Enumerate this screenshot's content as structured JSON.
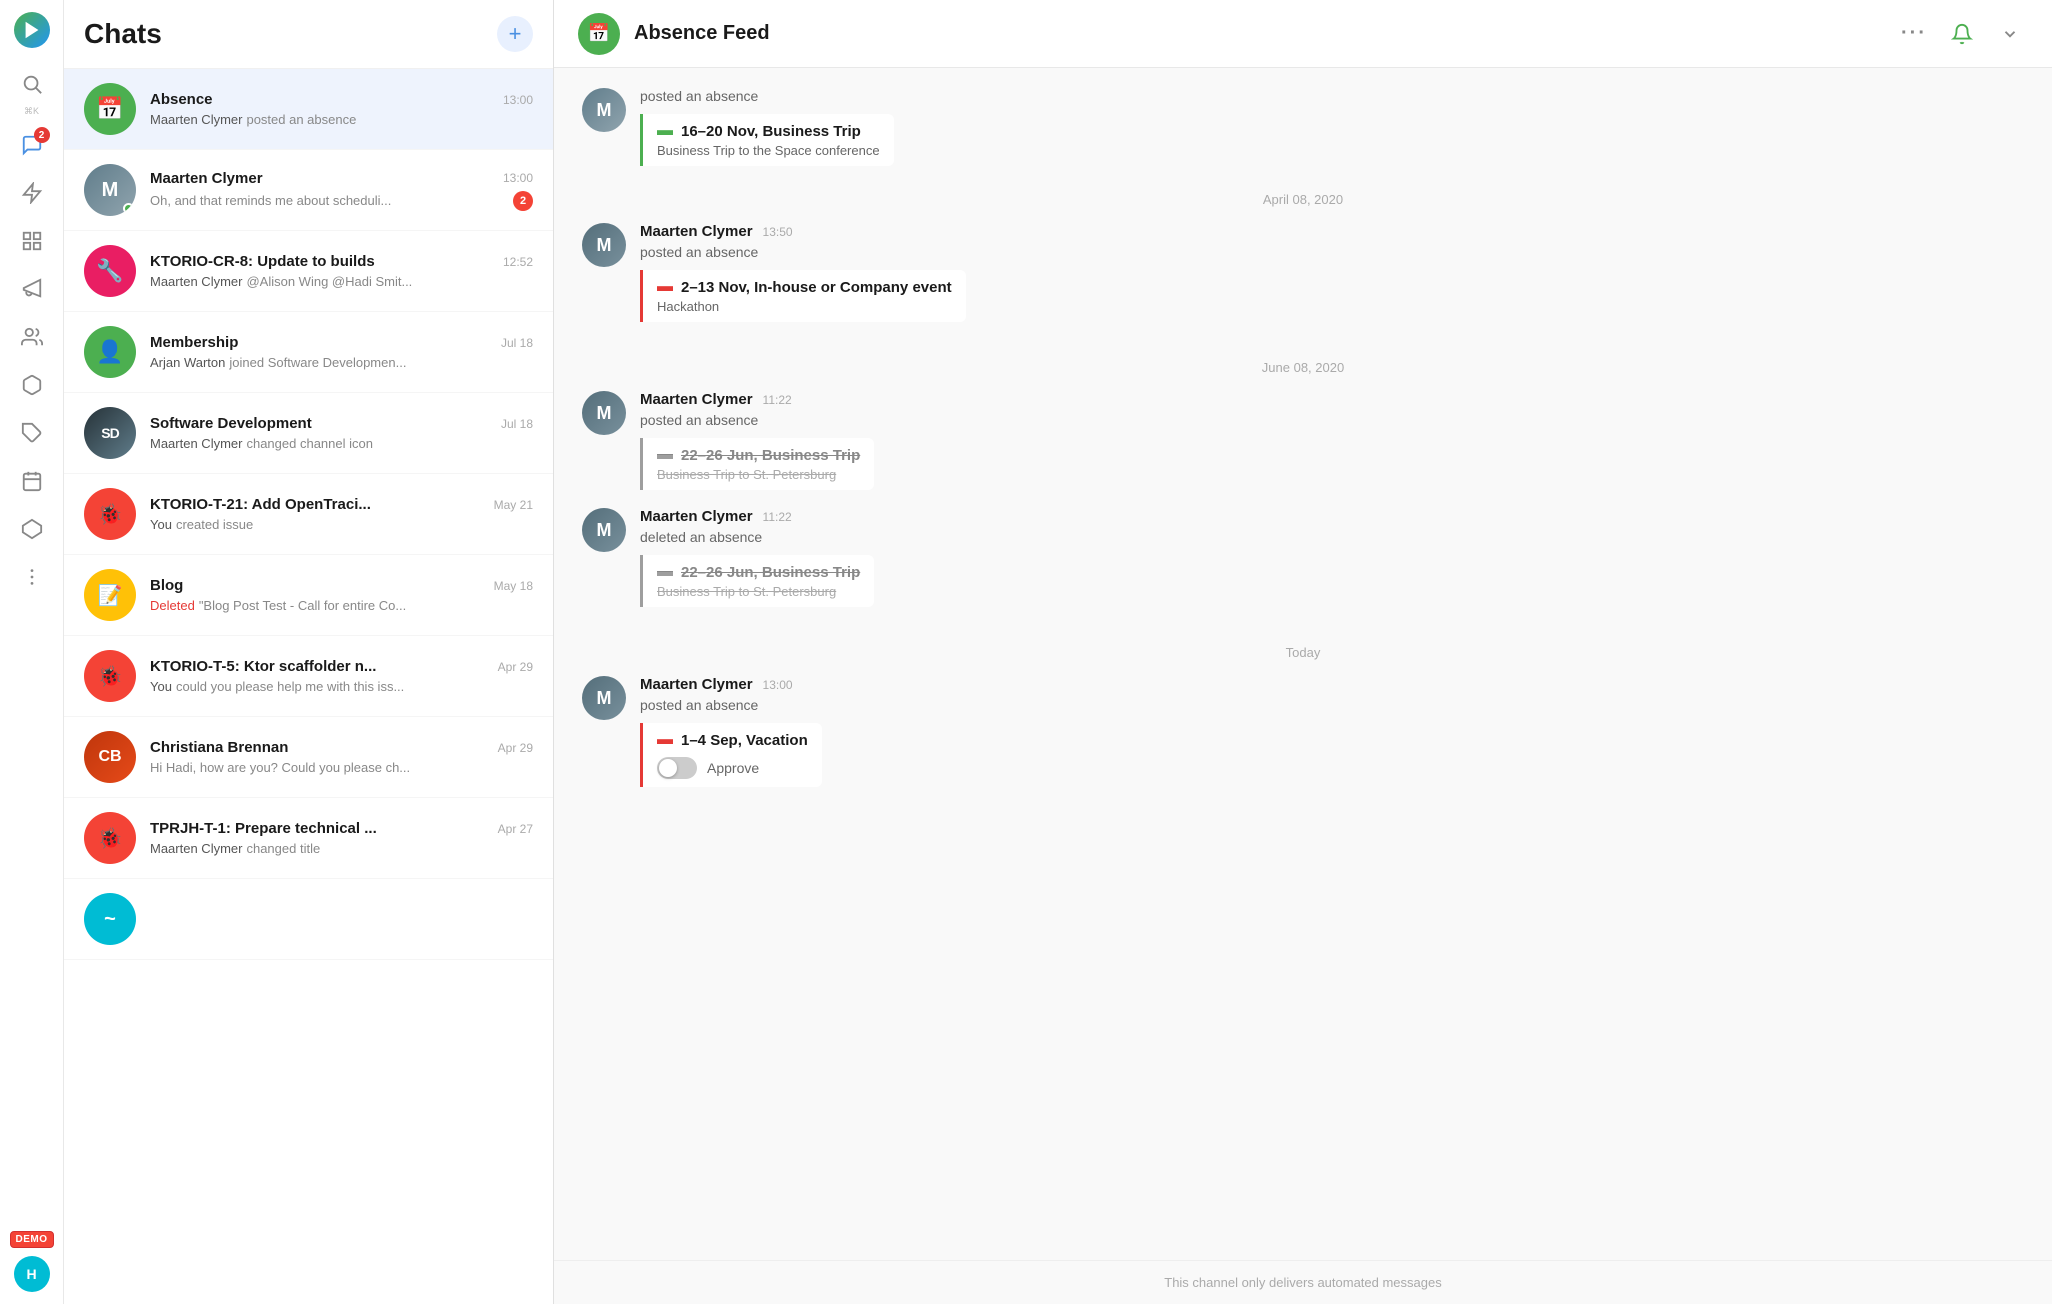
{
  "app": {
    "title": "Chats",
    "add_button": "+",
    "logo": "▶"
  },
  "nav": {
    "items": [
      {
        "id": "search",
        "icon": "search",
        "shortcut": "⌘K",
        "badge": null
      },
      {
        "id": "messages",
        "icon": "chat",
        "badge": "2"
      },
      {
        "id": "lightning",
        "icon": "lightning",
        "badge": null
      },
      {
        "id": "grid",
        "icon": "grid",
        "badge": null
      },
      {
        "id": "megaphone",
        "icon": "megaphone",
        "badge": null
      },
      {
        "id": "people",
        "icon": "people",
        "badge": null
      },
      {
        "id": "cube",
        "icon": "cube",
        "badge": null
      },
      {
        "id": "puzzle",
        "icon": "puzzle",
        "badge": null
      },
      {
        "id": "calendar",
        "icon": "calendar",
        "badge": null
      },
      {
        "id": "hexagon",
        "icon": "hexagon",
        "badge": null
      },
      {
        "id": "more",
        "icon": "more",
        "badge": null
      }
    ],
    "demo_label": "DEMO"
  },
  "chat_list": {
    "title": "Chats",
    "items": [
      {
        "id": "absence",
        "name": "Absence",
        "avatar_letter": "📅",
        "avatar_color": "av-green",
        "time": "13:00",
        "preview_sender": "Maarten Clymer",
        "preview_text": "posted an absence",
        "unread": null,
        "active": true
      },
      {
        "id": "maarten",
        "name": "Maarten Clymer",
        "avatar_color": "av-photo",
        "time": "13:00",
        "preview_sender": "",
        "preview_text": "Oh, and that reminds me about scheduli...",
        "unread": "2",
        "online": true
      },
      {
        "id": "ktorio-cr8",
        "name": "KTORIO-CR-8: Update to builds",
        "avatar_color": "av-pink",
        "avatar_letter": "🔧",
        "time": "12:52",
        "preview_sender": "Maarten Clymer",
        "preview_text": "@Alison Wing @Hadi Smit...",
        "unread": null
      },
      {
        "id": "membership",
        "name": "Membership",
        "avatar_color": "av-green",
        "avatar_letter": "👤",
        "time": "Jul 18",
        "preview_sender": "Arjan Warton",
        "preview_text": "joined Software Developmen...",
        "unread": null
      },
      {
        "id": "software-dev",
        "name": "Software Development",
        "avatar_color": "av-photo2",
        "time": "Jul 18",
        "preview_sender": "Maarten Clymer",
        "preview_text": "changed channel icon",
        "unread": null
      },
      {
        "id": "ktorio-t21",
        "name": "KTORIO-T-21: Add OpenTraci...",
        "avatar_color": "av-red",
        "avatar_letter": "🐞",
        "time": "May 21",
        "preview_sender": "You",
        "preview_text": "created issue",
        "unread": null
      },
      {
        "id": "blog",
        "name": "Blog",
        "avatar_color": "av-yellow",
        "avatar_letter": "📝",
        "time": "May 18",
        "preview_deleted": "Deleted",
        "preview_text": "\"Blog Post Test - Call for entire Co...",
        "unread": null
      },
      {
        "id": "ktorio-t5",
        "name": "KTORIO-T-5: Ktor scaffolder n...",
        "avatar_color": "av-red",
        "avatar_letter": "🐞",
        "time": "Apr 29",
        "preview_sender": "You",
        "preview_text": "could you please help me with this iss...",
        "unread": null
      },
      {
        "id": "christiana",
        "name": "Christiana Brennan",
        "avatar_color": "av-photo3",
        "time": "Apr 29",
        "preview_sender": "",
        "preview_text": "Hi Hadi, how are you? Could you please ch...",
        "unread": null
      },
      {
        "id": "tprjh-t1",
        "name": "TPRJH-T-1: Prepare technical ...",
        "avatar_color": "av-red",
        "avatar_letter": "🐞",
        "time": "Apr 27",
        "preview_sender": "Maarten Clymer",
        "preview_text": "changed title",
        "unread": null
      },
      {
        "id": "last-item",
        "name": "...",
        "avatar_color": "av-cyan",
        "avatar_letter": "?",
        "time": "",
        "preview_text": "",
        "unread": null
      }
    ]
  },
  "main_chat": {
    "header": {
      "title": "Absence Feed",
      "avatar_icon": "📅",
      "more_label": "···"
    },
    "messages": [
      {
        "id": "msg-pre1",
        "sender": null,
        "time": null,
        "action": "posted an absence",
        "absence": null,
        "no_sender_row": true,
        "indent": true
      },
      {
        "id": "msg-apr08-card",
        "date_divider": "April 08, 2020",
        "absence_title": "16–20 Nov, Business Trip",
        "absence_desc": "Business Trip to the Space conference",
        "card_type": "green"
      },
      {
        "id": "msg1",
        "sender": "Maarten Clymer",
        "time": "13:50",
        "action": "posted an absence",
        "absence_title": "2–13 Nov, In-house or Company event",
        "absence_desc": "Hackathon",
        "card_type": "red"
      },
      {
        "id": "date-jun",
        "date_divider": "June 08, 2020"
      },
      {
        "id": "msg2",
        "sender": "Maarten Clymer",
        "time": "11:22",
        "action": "posted an absence",
        "absence_title": "22–26 Jun, Business Trip",
        "absence_desc": "Business Trip to St. Petersburg",
        "card_type": "gray_strikethrough"
      },
      {
        "id": "msg3",
        "sender": "Maarten Clymer",
        "time": "11:22",
        "action": "deleted an absence",
        "absence_title": "22–26 Jun, Business Trip",
        "absence_desc": "Business Trip to St. Petersburg",
        "card_type": "gray_strikethrough"
      },
      {
        "id": "date-today",
        "date_divider": "Today"
      },
      {
        "id": "msg4",
        "sender": "Maarten Clymer",
        "time": "13:00",
        "action": "posted an absence",
        "absence_title": "1–4 Sep, Vacation",
        "absence_desc": null,
        "card_type": "red",
        "has_approve": true,
        "approve_label": "Approve"
      }
    ],
    "footer": "This channel only delivers automated messages"
  }
}
